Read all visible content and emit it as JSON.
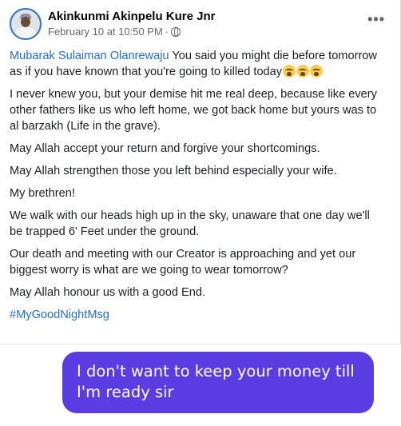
{
  "post": {
    "author": "Akinkunmi Akinpelu Kure Jnr",
    "timestamp": "February 10 at 10:50 PM",
    "separator": "·",
    "more_label": "•••",
    "mention": "Mubarak Sulaiman Olanrewaju",
    "p1_rest": " You said you might die before tomorrow as if you have known that you're going to killed today",
    "p2": "I never knew you, but your demise hit me real deep, because like every other fathers like us who left home, we got back home but yours was to al barzakh (Life in the grave).",
    "p3": "May Allah accept your return and forgive your shortcomings.",
    "p4": "May Allah strengthen those you left behind especially your wife.",
    "p5": "My brethren!",
    "p6": "We walk with our heads high up in the sky, unaware that one day we'll be trapped 6' Feet under the ground.",
    "p7": "Our death and meeting with our Creator is approaching and yet our biggest worry is what are we going to wear tomorrow?",
    "p8": "May Allah honour us with a good End.",
    "hashtag": "#MyGoodNightMsg",
    "privacy_icon": "globe-icon",
    "emoji": "crying-face"
  },
  "chat": {
    "message": "I don't want to keep your money till I'm ready sir",
    "bubble_color": "#5a3de2"
  },
  "colors": {
    "link": "#216fdb",
    "meta": "#65676b"
  }
}
